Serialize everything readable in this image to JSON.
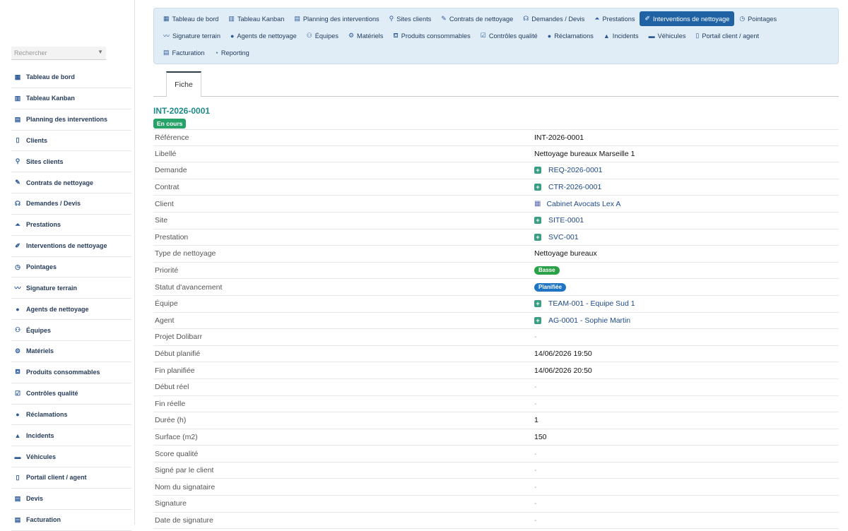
{
  "sidebar": {
    "search_placeholder": "Rechercher",
    "items": [
      {
        "label": "Tableau de bord",
        "icon": "grid-icon"
      },
      {
        "label": "Tableau Kanban",
        "icon": "kanban-icon"
      },
      {
        "label": "Planning des interventions",
        "icon": "calendar-icon"
      },
      {
        "label": "Clients",
        "icon": "building-icon"
      },
      {
        "label": "Sites clients",
        "icon": "map-pin-icon"
      },
      {
        "label": "Contrats de nettoyage",
        "icon": "contract-icon"
      },
      {
        "label": "Demandes / Devis",
        "icon": "headset-icon"
      },
      {
        "label": "Prestations",
        "icon": "broom-icon"
      },
      {
        "label": "Interventions de nettoyage",
        "icon": "brush-icon"
      },
      {
        "label": "Pointages",
        "icon": "clock-icon"
      },
      {
        "label": "Signature terrain",
        "icon": "signature-icon"
      },
      {
        "label": "Agents de nettoyage",
        "icon": "user-icon"
      },
      {
        "label": "Équipes",
        "icon": "users-icon"
      },
      {
        "label": "Matériels",
        "icon": "cogs-icon"
      },
      {
        "label": "Produits consommables",
        "icon": "spray-icon"
      },
      {
        "label": "Contrôles qualité",
        "icon": "clipboard-check-icon"
      },
      {
        "label": "Réclamations",
        "icon": "comment-icon"
      },
      {
        "label": "Incidents",
        "icon": "warning-icon"
      },
      {
        "label": "Véhicules",
        "icon": "truck-icon"
      },
      {
        "label": "Portail client / agent",
        "icon": "mobile-icon"
      },
      {
        "label": "Devis",
        "icon": "document-icon"
      },
      {
        "label": "Facturation",
        "icon": "invoice-icon"
      }
    ]
  },
  "topnav": {
    "rows": [
      [
        {
          "label": "Tableau de bord",
          "icon": "grid-icon",
          "active": false
        },
        {
          "label": "Tableau Kanban",
          "icon": "kanban-icon",
          "active": false
        },
        {
          "label": "Planning des interventions",
          "icon": "calendar-icon",
          "active": false
        },
        {
          "label": "Sites clients",
          "icon": "map-pin-icon",
          "active": false
        },
        {
          "label": "Contrats de nettoyage",
          "icon": "contract-icon",
          "active": false
        },
        {
          "label": "Demandes / Devis",
          "icon": "headset-icon",
          "active": false
        },
        {
          "label": "Prestations",
          "icon": "broom-icon",
          "active": false
        },
        {
          "label": "Interventions de nettoyage",
          "icon": "brush-icon",
          "active": true
        },
        {
          "label": "Pointages",
          "icon": "clock-icon",
          "active": false
        }
      ],
      [
        {
          "label": "Signature terrain",
          "icon": "signature-icon",
          "active": false
        },
        {
          "label": "Agents de nettoyage",
          "icon": "user-icon",
          "active": false
        },
        {
          "label": "Équipes",
          "icon": "users-icon",
          "active": false
        },
        {
          "label": "Matériels",
          "icon": "cogs-icon",
          "active": false
        },
        {
          "label": "Produits consommables",
          "icon": "spray-icon",
          "active": false
        },
        {
          "label": "Contrôles qualité",
          "icon": "clipboard-check-icon",
          "active": false
        },
        {
          "label": "Réclamations",
          "icon": "comment-icon",
          "active": false
        },
        {
          "label": "Incidents",
          "icon": "warning-icon",
          "active": false
        },
        {
          "label": "Véhicules",
          "icon": "truck-icon",
          "active": false
        },
        {
          "label": "Portail client / agent",
          "icon": "mobile-icon",
          "active": false
        }
      ],
      [
        {
          "label": "Facturation",
          "icon": "invoice-icon",
          "active": false
        },
        {
          "label": "Reporting",
          "icon": "pie-chart-icon",
          "active": false
        }
      ]
    ]
  },
  "tabs": {
    "fiche": "Fiche"
  },
  "record": {
    "title": "INT-2026-0001",
    "status": "En cours",
    "fields": [
      {
        "label": "Référence",
        "value": "INT-2026-0001",
        "kind": "text"
      },
      {
        "label": "Libellé",
        "value": "Nettoyage bureaux Marseille 1",
        "kind": "text"
      },
      {
        "label": "Demande",
        "value": "REQ-2026-0001",
        "kind": "link",
        "icon": "plus-square-icon"
      },
      {
        "label": "Contrat",
        "value": "CTR-2026-0001",
        "kind": "link",
        "icon": "plus-square-icon"
      },
      {
        "label": "Client",
        "value": "Cabinet Avocats Lex A",
        "kind": "link",
        "icon": "building-icon"
      },
      {
        "label": "Site",
        "value": "SITE-0001",
        "kind": "link",
        "icon": "plus-square-icon"
      },
      {
        "label": "Prestation",
        "value": "SVC-001",
        "kind": "link",
        "icon": "plus-square-icon"
      },
      {
        "label": "Type de nettoyage",
        "value": "Nettoyage bureaux",
        "kind": "text"
      },
      {
        "label": "Priorité",
        "value": "Basse",
        "kind": "badge",
        "color": "#2aa147"
      },
      {
        "label": "Statut d'avancement",
        "value": "Planifiée",
        "kind": "badge",
        "color": "#1f74c4"
      },
      {
        "label": "Équipe",
        "value": "TEAM-001 - Equipe Sud 1",
        "kind": "link",
        "icon": "plus-square-icon"
      },
      {
        "label": "Agent",
        "value": "AG-0001 - Sophie Martin",
        "kind": "link",
        "icon": "plus-square-icon"
      },
      {
        "label": "Projet Dolibarr",
        "value": "-",
        "kind": "empty"
      },
      {
        "label": "Début planifié",
        "value": "14/06/2026 19:50",
        "kind": "text"
      },
      {
        "label": "Fin planifiée",
        "value": "14/06/2026 20:50",
        "kind": "text"
      },
      {
        "label": "Début réel",
        "value": "-",
        "kind": "empty"
      },
      {
        "label": "Fin réelle",
        "value": "-",
        "kind": "empty"
      },
      {
        "label": "Durée (h)",
        "value": "1",
        "kind": "text"
      },
      {
        "label": "Surface (m2)",
        "value": "150",
        "kind": "text"
      },
      {
        "label": "Score qualité",
        "value": "-",
        "kind": "empty"
      },
      {
        "label": "Signé par le client",
        "value": "-",
        "kind": "empty"
      },
      {
        "label": "Nom du signataire",
        "value": "-",
        "kind": "empty"
      },
      {
        "label": "Signature",
        "value": "-",
        "kind": "empty"
      },
      {
        "label": "Date de signature",
        "value": "-",
        "kind": "empty"
      }
    ]
  },
  "colors": {
    "accent": "#2063a4",
    "status_badge": "#27a36a",
    "title": "#1f8a8a",
    "link": "#1e4a88"
  }
}
